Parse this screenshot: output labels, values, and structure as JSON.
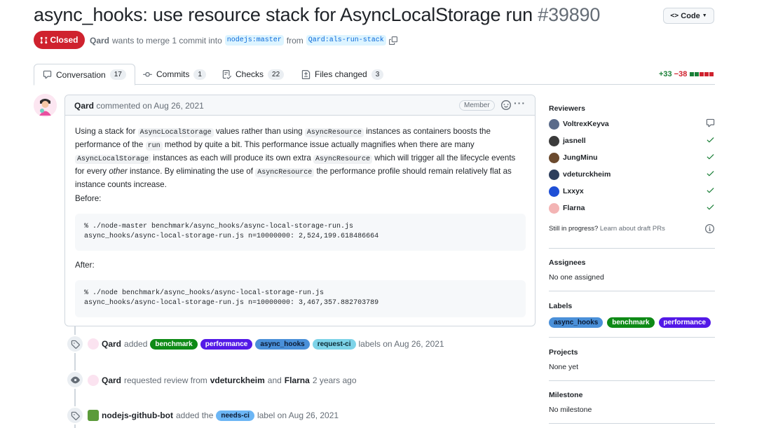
{
  "header": {
    "title": "async_hooks: use resource stack for AsyncLocalStorage run",
    "number": "#39890",
    "code_button": "Code",
    "status": "Closed",
    "author": "Qard",
    "merge_text": "wants to merge 1 commit into",
    "base_branch": "nodejs:master",
    "from_text": "from",
    "head_branch": "Qard:als-run-stack"
  },
  "tabs": [
    {
      "label": "Conversation",
      "count": "17"
    },
    {
      "label": "Commits",
      "count": "1"
    },
    {
      "label": "Checks",
      "count": "22"
    },
    {
      "label": "Files changed",
      "count": "3"
    }
  ],
  "diffstat": {
    "additions": "+33",
    "deletions": "−38"
  },
  "comment": {
    "author": "Qard",
    "action": "commented on Aug 26, 2021",
    "role": "Member",
    "p1_a": "Using a stack for",
    "p1_code1": "AsyncLocalStorage",
    "p1_b": "values rather than using",
    "p1_code2": "AsyncResource",
    "p1_c": "instances as containers boosts the performance of the",
    "p1_code3": "run",
    "p1_d": "method by quite a bit. This performance issue actually magnifies when there are many",
    "p1_code4": "AsyncLocalStorage",
    "p1_e": "instances as each will produce its own extra",
    "p1_code5": "AsyncResource",
    "p1_f": "which will trigger all the lifecycle events for every",
    "p1_em": "other",
    "p1_g": "instance. By eliminating the use of",
    "p1_code6": "AsyncResource",
    "p1_h": "the performance profile should remain relatively flat as instance counts increase.",
    "before_label": "Before:",
    "before_code": "% ./node-master benchmark/async_hooks/async-local-storage-run.js\nasync_hooks/async-local-storage-run.js n=10000000: 2,524,199.618486664",
    "after_label": "After:",
    "after_code": "% ./node benchmark/async_hooks/async-local-storage-run.js\nasync_hooks/async-local-storage-run.js n=10000000: 3,467,357.882703789"
  },
  "timeline": [
    {
      "actor": "Qard",
      "text": "added",
      "labels": [
        "benchmark",
        "performance",
        "async_hooks",
        "request-ci"
      ],
      "suffix": "labels on Aug 26, 2021"
    },
    {
      "actor": "Qard",
      "text": "requested review from",
      "target1": "vdeturckheim",
      "and": "and",
      "target2": "Flarna",
      "suffix": "2 years ago"
    },
    {
      "actor": "nodejs-github-bot",
      "text": "added the",
      "labels": [
        "needs-ci"
      ],
      "suffix": "label on Aug 26, 2021"
    }
  ],
  "label_colors": {
    "benchmark": "#0e8a16",
    "performance": "#5319e7",
    "async_hooks": "#4a90d9",
    "request-ci": "#7dd3e8",
    "needs-ci": "#6cb6f5"
  },
  "sidebar": {
    "reviewers_title": "Reviewers",
    "reviewers": [
      "VoltrexKeyva",
      "jasnell",
      "JungMinu",
      "vdeturckheim",
      "Lxxyx",
      "Flarna"
    ],
    "draft_text": "Still in progress?",
    "draft_link": "Learn about draft PRs",
    "assignees_title": "Assignees",
    "assignees_value": "No one assigned",
    "labels_title": "Labels",
    "labels": [
      "async_hooks",
      "benchmark",
      "performance"
    ],
    "projects_title": "Projects",
    "projects_value": "None yet",
    "milestone_title": "Milestone",
    "milestone_value": "No milestone"
  }
}
